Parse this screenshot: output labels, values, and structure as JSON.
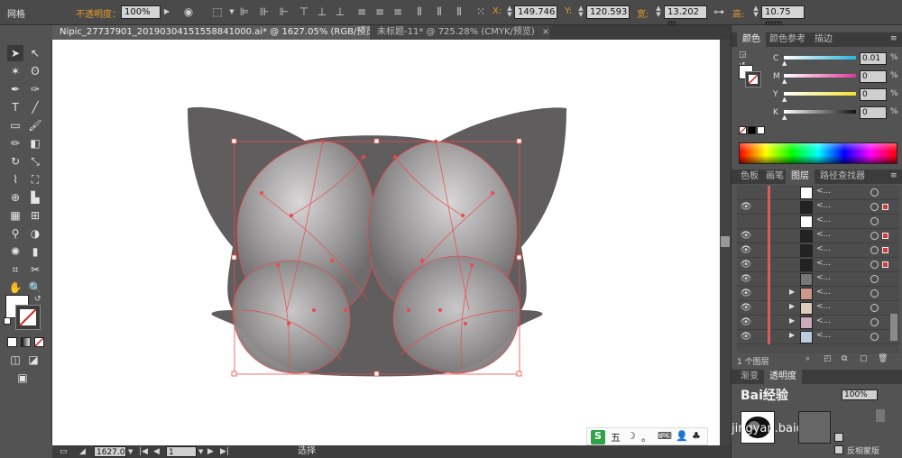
{
  "control_bar": {
    "mode_label": "网格",
    "opacity_label": "不透明度：",
    "opacity_value": "100%",
    "x_label": "X:",
    "x_value": "149.746",
    "y_label": "Y:",
    "y_value": "120.593",
    "width_label": "宽:",
    "width_value": "13.202 m",
    "height_label": "高:",
    "height_value": "10.75 mm"
  },
  "tabs": [
    {
      "label": "Nipic_27737901_20190304151558841000.ai* @ 1627.05% (RGB/预览)",
      "close": "×"
    },
    {
      "label": "未标题-11* @ 725.28% (CMYK/预览)",
      "close": "×"
    }
  ],
  "status_bar": {
    "zoom": "1627.0",
    "page": "1",
    "tool": "选择"
  },
  "color_panel": {
    "tabs": [
      "颜色",
      "颜色参考",
      "描边"
    ],
    "channels": [
      {
        "name": "C",
        "value": "0.01"
      },
      {
        "name": "M",
        "value": "0"
      },
      {
        "name": "Y",
        "value": "0"
      },
      {
        "name": "K",
        "value": "0"
      }
    ],
    "percent": "%",
    "colors": {
      "cyan": "#2ab4d9",
      "magenta": "#e0389a",
      "yellow": "#f2e22e",
      "black": "#111111"
    }
  },
  "layers_panel": {
    "tabs": [
      "色板",
      "画笔",
      "图层",
      "路径查找器"
    ],
    "layer_names": [
      "<...",
      "<...",
      "<...",
      "<...",
      "<...",
      "<...",
      "<...",
      "<...",
      "<...",
      "<...",
      "<...",
      "<..."
    ],
    "footer": "1 个图层"
  },
  "lower_panel": {
    "tabs": [
      "渐变",
      "透明度"
    ],
    "opacity_value": "100%",
    "checkbox_label": "反相蒙版"
  },
  "watermark": {
    "text": "Bai经验",
    "url_text": "jingyan.baidu"
  },
  "ime": {
    "glyphs": [
      "S",
      "五",
      "☽",
      "。",
      "⌨",
      "👤",
      "♣"
    ]
  }
}
